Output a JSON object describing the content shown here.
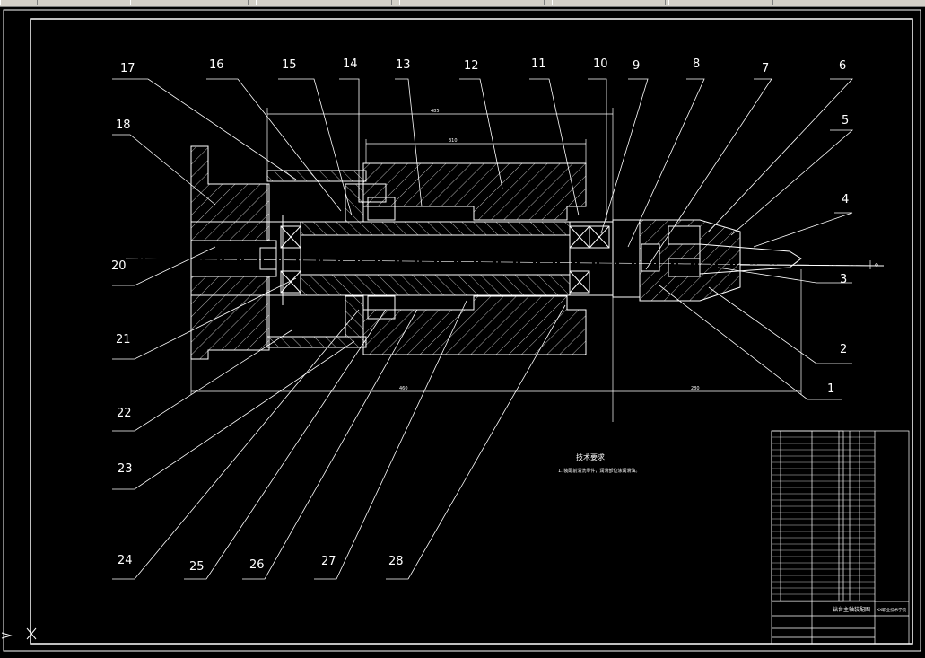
{
  "drawing": {
    "balloons": [
      "1",
      "2",
      "3",
      "4",
      "5",
      "6",
      "7",
      "8",
      "9",
      "10",
      "11",
      "12",
      "13",
      "14",
      "15",
      "16",
      "17",
      "18",
      "20",
      "21",
      "22",
      "23",
      "24",
      "25",
      "26",
      "27",
      "28"
    ],
    "tech_requirements": {
      "title": "技术要求",
      "line1": "1. 装配前清洗零件，润滑部位涂润滑油。"
    },
    "title_block": {
      "drawing_name": "钻台主轴装配图",
      "school": "XX职业技术学院"
    },
    "colors": {
      "background": "#000000",
      "lines": "#ffffff",
      "toolbar": "#d4d0c8"
    }
  }
}
